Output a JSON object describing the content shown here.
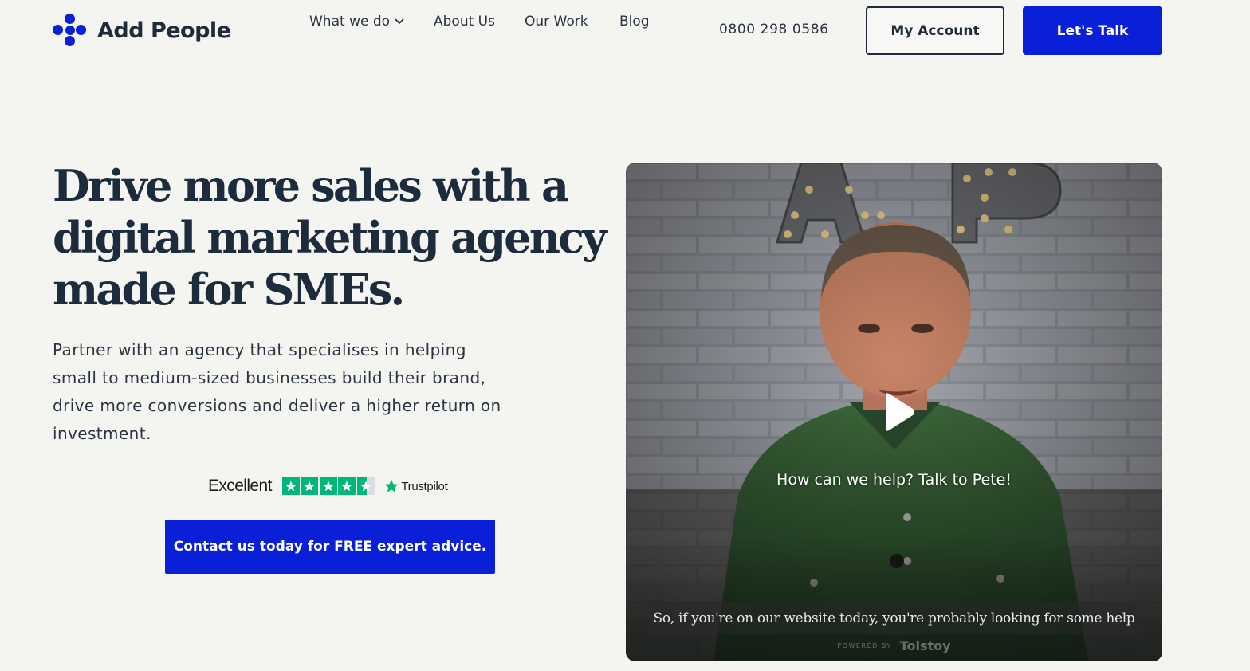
{
  "brand": {
    "name": "Add People",
    "color": "#0a1fd8"
  },
  "nav": {
    "items": [
      {
        "label": "What we do",
        "has_dropdown": true
      },
      {
        "label": "About Us"
      },
      {
        "label": "Our Work"
      },
      {
        "label": "Blog"
      }
    ],
    "phone": "0800 298 0586",
    "account_label": "My Account",
    "talk_label": "Let's Talk"
  },
  "hero": {
    "headline_lines": [
      "Drive more sales with a",
      "digital marketing agency",
      "made for SMEs."
    ],
    "subtext_lines": [
      "Partner with an agency that specialises in helping",
      "small to medium-sized businesses build their brand,",
      "drive more conversions and deliver a higher return on",
      "investment."
    ],
    "trust_rating_label": "Excellent",
    "trust_brand": "Trustpilot",
    "trust_stars": 4.5,
    "cta_label": "Contact us today for FREE expert advice."
  },
  "video": {
    "title": "How can we help? Talk to Pete!",
    "caption": "So, if you're on our website today, you're probably looking for some help",
    "powered_by": "POWERED BY",
    "powered_brand": "Tolstoy",
    "play_icon": "play-icon"
  }
}
